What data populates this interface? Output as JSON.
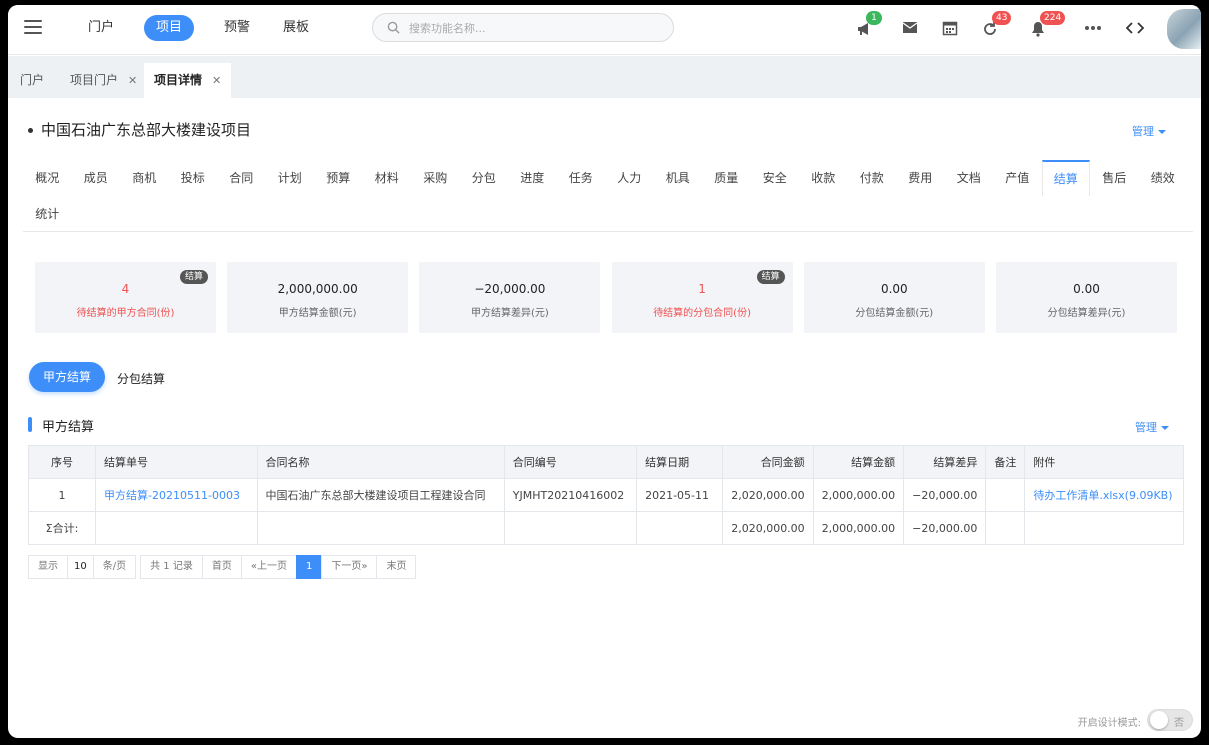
{
  "topnav": {
    "items": [
      {
        "label": "门户",
        "active": false
      },
      {
        "label": "项目",
        "active": true
      },
      {
        "label": "预警",
        "active": false
      },
      {
        "label": "展板",
        "active": false
      }
    ],
    "search_placeholder": "搜索功能名称...",
    "badges": {
      "notice": "1",
      "refresh": "43",
      "bell": "224"
    },
    "icons": [
      "megaphone-icon",
      "mail-icon",
      "calendar-icon",
      "refresh-icon",
      "bell-icon",
      "more-icon",
      "code-icon"
    ]
  },
  "tabs": [
    {
      "label": "门户",
      "closable": false,
      "active": false
    },
    {
      "label": "项目门户",
      "closable": true,
      "active": false
    },
    {
      "label": "项目详情",
      "closable": true,
      "active": true
    }
  ],
  "project": {
    "title": "中国石油广东总部大楼建设项目",
    "manage_label": "管理"
  },
  "module_tabs": [
    "概况",
    "成员",
    "商机",
    "投标",
    "合同",
    "计划",
    "预算",
    "材料",
    "采购",
    "分包",
    "进度",
    "任务",
    "人力",
    "机具",
    "质量",
    "安全",
    "收款",
    "付款",
    "费用",
    "文档",
    "产值",
    "结算",
    "售后",
    "绩效",
    "统计"
  ],
  "active_module": "结算",
  "stats": [
    {
      "value": "4",
      "label": "待结算的甲方合同(份)",
      "tag": "结算",
      "red": true
    },
    {
      "value": "2,000,000.00",
      "label": "甲方结算金额(元)",
      "tag": "",
      "red": false
    },
    {
      "value": "−20,000.00",
      "label": "甲方结算差异(元)",
      "tag": "",
      "red": false
    },
    {
      "value": "1",
      "label": "待结算的分包合同(份)",
      "tag": "结算",
      "red": true
    },
    {
      "value": "0.00",
      "label": "分包结算金额(元)",
      "tag": "",
      "red": false
    },
    {
      "value": "0.00",
      "label": "分包结算差异(元)",
      "tag": "",
      "red": false
    }
  ],
  "subtabs": {
    "active": "甲方结算",
    "other": "分包结算"
  },
  "section": {
    "title": "甲方结算",
    "manage_label": "管理"
  },
  "table": {
    "headers": [
      "序号",
      "结算单号",
      "合同名称",
      "合同编号",
      "结算日期",
      "合同金额",
      "结算金额",
      "结算差异",
      "备注",
      "附件"
    ],
    "rows": [
      [
        "1",
        "甲方结算-20210511-0003",
        "中国石油广东总部大楼建设项目工程建设合同",
        "YJMHT20210416002",
        "2021-05-11",
        "2,020,000.00",
        "2,000,000.00",
        "−20,000.00",
        "",
        "待办工作清单.xlsx(9.09KB)"
      ]
    ],
    "total": {
      "label": "Σ合计:",
      "contract_amount": "2,020,000.00",
      "settle_amount": "2,000,000.00",
      "diff": "−20,000.00"
    }
  },
  "pager": {
    "show": "显示",
    "size": "10",
    "per_page": "条/页",
    "total": "共 1 记录",
    "first": "首页",
    "prev": "«上一页",
    "current": "1",
    "next": "下一页»",
    "last": "末页"
  },
  "design_mode": {
    "label": "开启设计模式:",
    "state": "否"
  }
}
